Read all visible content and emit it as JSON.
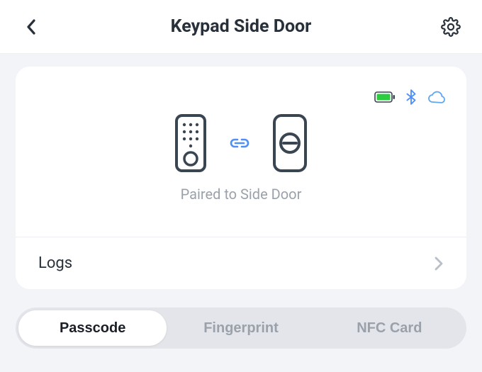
{
  "header": {
    "title": "Keypad Side Door"
  },
  "card": {
    "pairing_label": "Paired to Side Door"
  },
  "logs": {
    "label": "Logs"
  },
  "tabs": {
    "items": [
      {
        "label": "Passcode"
      },
      {
        "label": "Fingerprint"
      },
      {
        "label": "NFC Card"
      }
    ],
    "active_index": 0
  },
  "status": {
    "battery": "full",
    "bluetooth": "connected",
    "cloud": "connected"
  },
  "colors": {
    "text_primary": "#28303a",
    "text_muted": "#9aa1ab",
    "icon_outline": "#3a4552",
    "accent_blue": "#4f8ff7",
    "battery_green": "#2ecc40",
    "cloud_blue": "#5fa8ef",
    "bg_page": "#f3f4f7",
    "bg_card": "#ffffff",
    "seg_bg": "#e3e5ea"
  }
}
